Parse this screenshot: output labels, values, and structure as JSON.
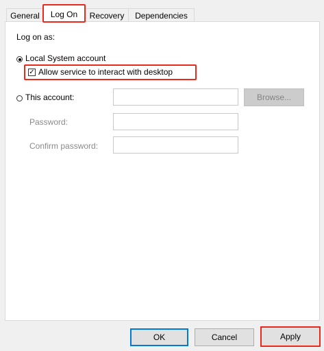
{
  "tabs": [
    {
      "label": "General",
      "active": false
    },
    {
      "label": "Log On",
      "active": true
    },
    {
      "label": "Recovery",
      "active": false
    },
    {
      "label": "Dependencies",
      "active": false
    }
  ],
  "logon": {
    "heading": "Log on as:",
    "local_system": {
      "label": "Local System account",
      "selected": true
    },
    "interact_desktop": {
      "label": "Allow service to interact with desktop",
      "checked": true
    },
    "this_account": {
      "label": "This account:",
      "selected": false,
      "value": ""
    },
    "password": {
      "label": "Password:",
      "value": ""
    },
    "confirm_password": {
      "label": "Confirm password:",
      "value": ""
    },
    "browse_label": "Browse..."
  },
  "footer": {
    "ok_label": "OK",
    "cancel_label": "Cancel",
    "apply_label": "Apply"
  },
  "colors": {
    "highlight": "#e8291c",
    "default_button_border": "#0078d7"
  }
}
